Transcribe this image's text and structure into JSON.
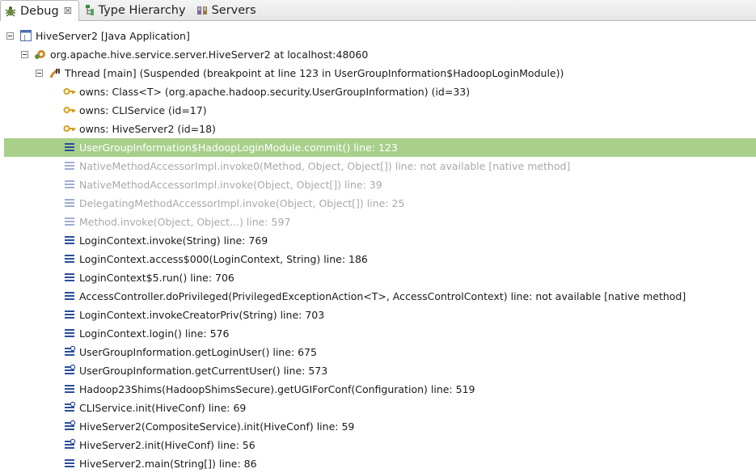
{
  "tabs": [
    {
      "label": "Debug",
      "close": "☒",
      "icon": "debug-icon"
    },
    {
      "label": "Type Hierarchy",
      "icon": "type-hierarchy-icon"
    },
    {
      "label": "Servers",
      "icon": "servers-icon"
    }
  ],
  "tree": {
    "launch": {
      "label": "HiveServer2 [Java Application]",
      "icon": "java-application-icon"
    },
    "target": {
      "label": "org.apache.hive.service.server.HiveServer2 at localhost:48060",
      "icon": "debug-target-icon"
    },
    "thread": {
      "label": "Thread [main] (Suspended (breakpoint at line 123 in UserGroupInformation$HadoopLoginModule))",
      "icon": "suspended-thread-icon"
    },
    "monitors": [
      {
        "label": "owns: Class<T> (org.apache.hadoop.security.UserGroupInformation) (id=33)",
        "icon": "monitor-key-icon"
      },
      {
        "label": "owns: CLIService  (id=17)",
        "icon": "monitor-key-icon"
      },
      {
        "label": "owns: HiveServer2  (id=18)",
        "icon": "monitor-key-icon"
      }
    ],
    "frames": [
      {
        "label": "UserGroupInformation$HadoopLoginModule.commit() line: 123",
        "state": "selected",
        "icon": "stack-frame-icon"
      },
      {
        "label": "NativeMethodAccessorImpl.invoke0(Method, Object, Object[]) line: not available [native method]",
        "state": "filtered",
        "icon": "stack-frame-icon"
      },
      {
        "label": "NativeMethodAccessorImpl.invoke(Object, Object[]) line: 39",
        "state": "filtered",
        "icon": "stack-frame-icon"
      },
      {
        "label": "DelegatingMethodAccessorImpl.invoke(Object, Object[]) line: 25",
        "state": "filtered",
        "icon": "stack-frame-icon"
      },
      {
        "label": "Method.invoke(Object, Object...) line: 597",
        "state": "filtered",
        "icon": "stack-frame-icon"
      },
      {
        "label": "LoginContext.invoke(String) line: 769",
        "state": "normal",
        "icon": "stack-frame-icon"
      },
      {
        "label": "LoginContext.access$000(LoginContext, String) line: 186",
        "state": "normal",
        "icon": "stack-frame-icon"
      },
      {
        "label": "LoginContext$5.run() line: 706",
        "state": "normal",
        "icon": "stack-frame-icon"
      },
      {
        "label": "AccessController.doPrivileged(PrivilegedExceptionAction<T>, AccessControlContext) line: not available [native method]",
        "state": "normal",
        "icon": "stack-frame-icon"
      },
      {
        "label": "LoginContext.invokeCreatorPriv(String) line: 703",
        "state": "normal",
        "icon": "stack-frame-icon"
      },
      {
        "label": "LoginContext.login() line: 576",
        "state": "normal",
        "icon": "stack-frame-icon"
      },
      {
        "label": "UserGroupInformation.getLoginUser() line: 675",
        "state": "normal",
        "icon": "stack-frame-synchronized-icon"
      },
      {
        "label": "UserGroupInformation.getCurrentUser() line: 573",
        "state": "normal",
        "icon": "stack-frame-synchronized-icon"
      },
      {
        "label": "Hadoop23Shims(HadoopShimsSecure).getUGIForConf(Configuration) line: 519",
        "state": "normal",
        "icon": "stack-frame-icon"
      },
      {
        "label": "CLIService.init(HiveConf) line: 69",
        "state": "normal",
        "icon": "stack-frame-synchronized-icon"
      },
      {
        "label": "HiveServer2(CompositeService).init(HiveConf) line: 59",
        "state": "normal",
        "icon": "stack-frame-synchronized-icon"
      },
      {
        "label": "HiveServer2.init(HiveConf) line: 56",
        "state": "normal",
        "icon": "stack-frame-synchronized-icon"
      },
      {
        "label": "HiveServer2.main(String[]) line: 86",
        "state": "normal",
        "icon": "stack-frame-icon"
      }
    ]
  },
  "colors": {
    "selection": "#a8d08b",
    "frame_icon": "#2a4e9a",
    "filtered_text": "#a9a9a9",
    "monitor_key": "#d4a017"
  }
}
